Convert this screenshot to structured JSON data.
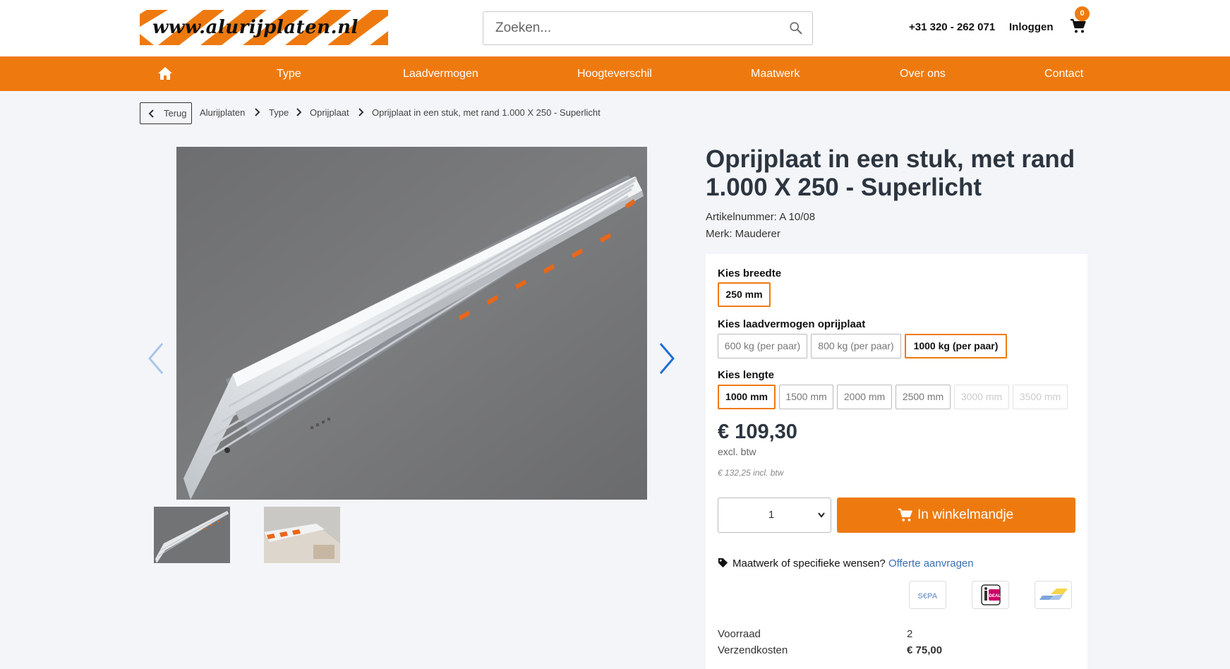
{
  "header": {
    "logo_text": "www.alurijplaten.nl",
    "search_placeholder": "Zoeken...",
    "phone": "+31 320 - 262 071",
    "login": "Inloggen",
    "cart_count": "0"
  },
  "nav": {
    "items": [
      "Type",
      "Laadvermogen",
      "Hoogteverschil",
      "Maatwerk",
      "Over ons",
      "Contact"
    ]
  },
  "breadcrumb": {
    "back": "Terug",
    "items": [
      "Alurijplaten",
      "Type",
      "Oprijplaat",
      "Oprijplaat in een stuk, met rand 1.000 X 250 - Superlicht"
    ]
  },
  "product": {
    "title": "Oprijplaat in een stuk, met rand 1.000 X 250 - Superlicht",
    "article_number": "Artikelnummer: A 10/08",
    "brand": "Merk: Mauderer",
    "options": {
      "width_label": "Kies breedte",
      "widths": [
        "250 mm"
      ],
      "capacity_label": "Kies laadvermogen oprijplaat",
      "capacities": [
        "600 kg (per paar)",
        "800 kg (per paar)",
        "1000 kg (per paar)"
      ],
      "length_label": "Kies lengte",
      "lengths": [
        "1000 mm",
        "1500 mm",
        "2000 mm",
        "2500 mm",
        "3000 mm",
        "3500 mm"
      ]
    },
    "price": "€ 109,30",
    "price_excl": "excl. btw",
    "price_incl": "€ 132,25 incl. btw",
    "quantity": "1",
    "add_to_cart": "In winkelmandje",
    "custom_text": "Maatwerk of specifieke wensen?",
    "custom_link": "Offerte aanvragen",
    "payment_methods": [
      "SEPA",
      "iDEAL",
      "Bancontact"
    ],
    "stock_label": "Voorraad",
    "stock_value": "2",
    "shipping_label": "Verzendkosten",
    "shipping_value": "€ 75,00"
  },
  "colors": {
    "accent": "#ee7a0f",
    "link": "#3a6fb5",
    "title": "#2c3540"
  }
}
